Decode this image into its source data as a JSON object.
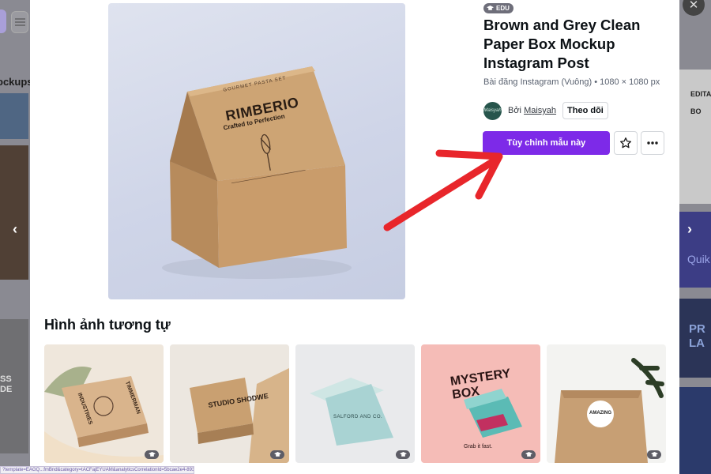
{
  "background": {
    "left_heading": "ockups",
    "left_card_text": "SS\nDE",
    "right_card1_text": "EDITAB\nBO",
    "right_card2_text": "Quik",
    "right_card3_text": "PR\nLA"
  },
  "template": {
    "badge": "EDU",
    "title": "Brown and Grey Clean Paper Box Mockup Instagram Post",
    "subtitle": "Bài đăng Instagram (Vuông) • 1080 × 1080 px",
    "author_prefix": "Bởi",
    "author_name": "Maisyah",
    "avatar_text": "Maisyah",
    "follow_label": "Theo dõi",
    "cta_label": "Tùy chỉnh mẫu này",
    "box_brand": "RIMBERIO",
    "box_tagline": "Crafted to Perfection",
    "box_top_text": "GOURMET PASTA SET"
  },
  "similar": {
    "heading": "Hình ảnh tương tự",
    "items": [
      {
        "label": "INDUSTRIES",
        "label2": "TIMMERMAN"
      },
      {
        "label": "STUDIO SHODWE"
      },
      {
        "label": "SALFORD AND CO."
      },
      {
        "label": "MYSTERY BOX",
        "label2": "Grab it fast."
      },
      {
        "label": "AMAZING"
      }
    ]
  },
  "status_bar": {
    "url": "?template=EAGQ...fmBnd&category=tACFajEYUAM&analyticsCorrelationId=5bcae2e4-8938-4bc..."
  },
  "colors": {
    "accent": "#7d2ae8",
    "arrow": "#e8262b"
  }
}
